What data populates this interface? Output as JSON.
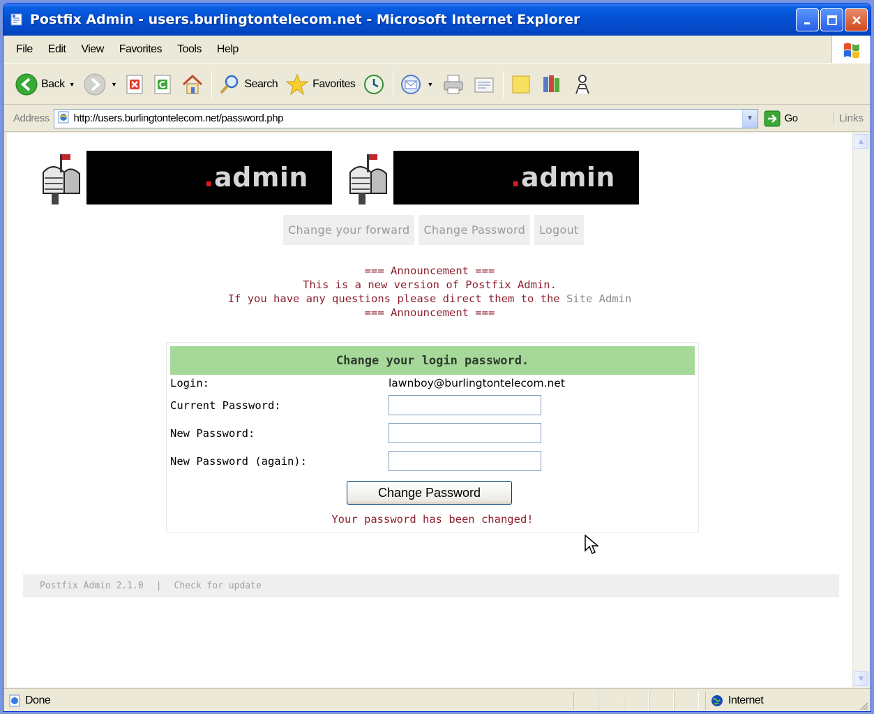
{
  "window": {
    "title": "Postfix Admin - users.burlingtontelecom.net - Microsoft Internet Explorer"
  },
  "menu": [
    "File",
    "Edit",
    "View",
    "Favorites",
    "Tools",
    "Help"
  ],
  "toolbar": {
    "back_label": "Back",
    "search_label": "Search",
    "favorites_label": "Favorites"
  },
  "address": {
    "label": "Address",
    "url": "http://users.burlingtontelecom.net/password.php",
    "go_label": "Go",
    "links_label": "Links"
  },
  "logo": {
    "dot": ".",
    "text": "admin"
  },
  "nav": [
    "Change your forward",
    "Change Password",
    "Logout"
  ],
  "announcement": {
    "line1": "=== Announcement ===",
    "line2": "This is a new version of Postfix Admin.",
    "line3_prefix": "If you have any questions please direct them to the ",
    "line3_link": "Site Admin",
    "line4": "=== Announcement ==="
  },
  "form": {
    "title": "Change your login password.",
    "login_label": "Login:",
    "login_value": "lawnboy@burlingtontelecom.net",
    "current_password_label": "Current Password:",
    "new_password_label": "New Password:",
    "new_password_again_label": "New Password (again):",
    "submit_label": "Change Password",
    "status_message": "Your password has been changed!"
  },
  "footer": {
    "version": "Postfix Admin 2.1.0",
    "separator": "|",
    "update_link": "Check for update"
  },
  "statusbar": {
    "status": "Done",
    "zone": "Internet"
  },
  "colors": {
    "form_header": "#a6d89a",
    "announcement_text": "#8b1f2e",
    "titlebar": "#0552d4"
  }
}
